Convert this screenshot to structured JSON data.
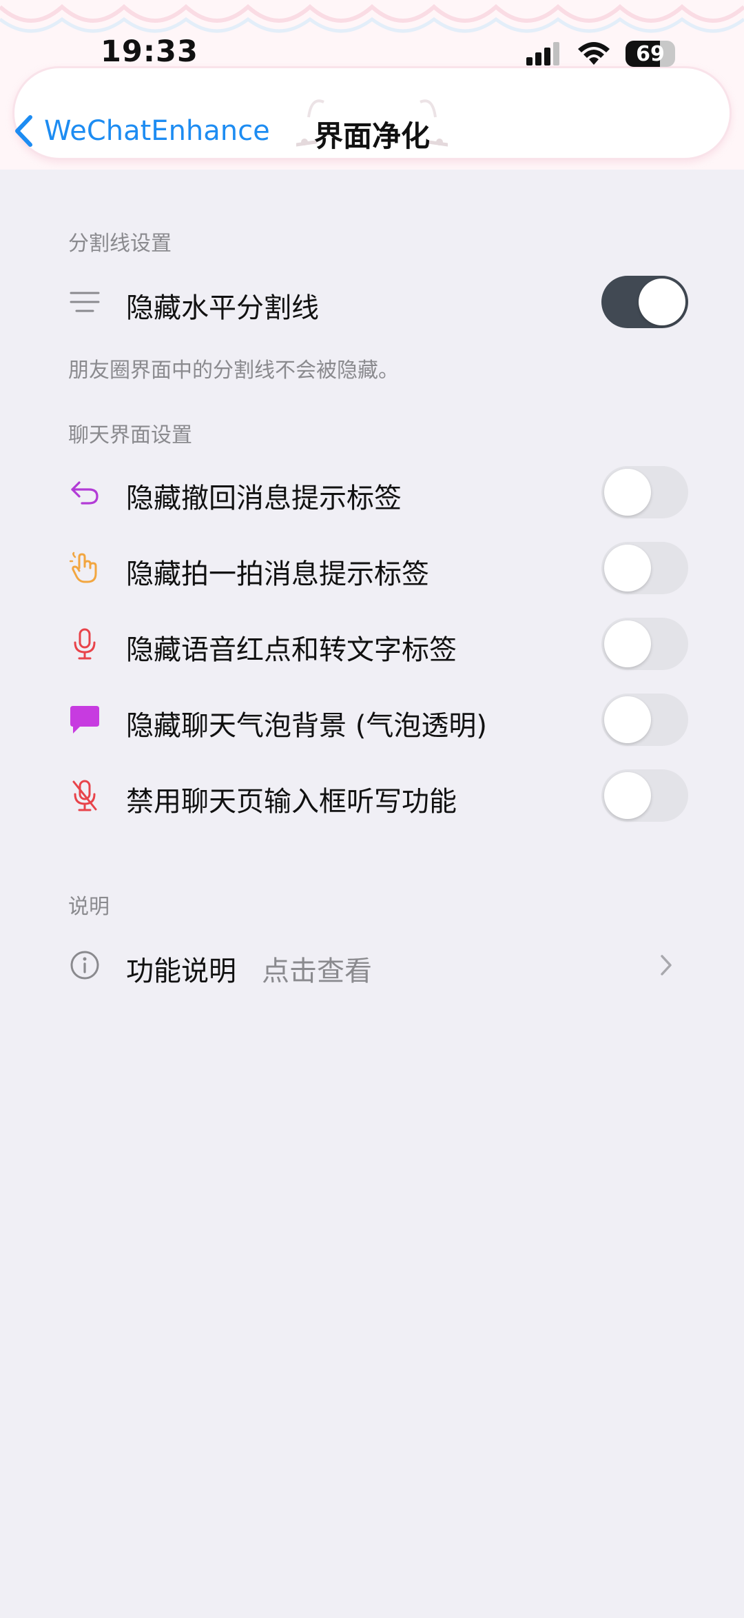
{
  "status_bar": {
    "time": "19:33",
    "battery_percent": "69",
    "battery_level": 0.69,
    "icons": [
      "cellular-signal-icon",
      "wifi-icon",
      "battery-icon"
    ]
  },
  "nav": {
    "back_label": "WeChatEnhance",
    "title": "界面净化"
  },
  "sections": {
    "divider": {
      "header": "分割线设置",
      "rows": [
        {
          "label": "隐藏水平分割线",
          "icon": "lines-icon",
          "enabled": true
        }
      ],
      "note": "朋友圈界面中的分割线不会被隐藏。"
    },
    "chat": {
      "header": "聊天界面设置",
      "rows": [
        {
          "label": "隐藏撤回消息提示标签",
          "icon": "undo-arrow-icon",
          "enabled": false
        },
        {
          "label": "隐藏拍一拍消息提示标签",
          "icon": "hand-tap-icon",
          "enabled": false
        },
        {
          "label": "隐藏语音红点和转文字标签",
          "icon": "microphone-icon",
          "enabled": false
        },
        {
          "label": "隐藏聊天气泡背景 (气泡透明)",
          "icon": "chat-bubble-icon",
          "enabled": false
        },
        {
          "label": "禁用聊天页输入框听写功能",
          "icon": "microphone-off-icon",
          "enabled": false
        }
      ]
    },
    "about": {
      "header": "说明",
      "row": {
        "label": "功能说明",
        "value": "点击查看",
        "icon": "info-icon"
      }
    }
  },
  "colors": {
    "accent": "#1d8cf2",
    "page_background": "#f0eff5",
    "toggle_on": "#414953",
    "toggle_off": "#e3e3e8",
    "undo_icon": "#b23bd6",
    "hand_icon": "#f2a640",
    "mic_icon": "#e8434a",
    "bubble_icon": "#c73be0",
    "mic_off_icon": "#e8434a"
  }
}
